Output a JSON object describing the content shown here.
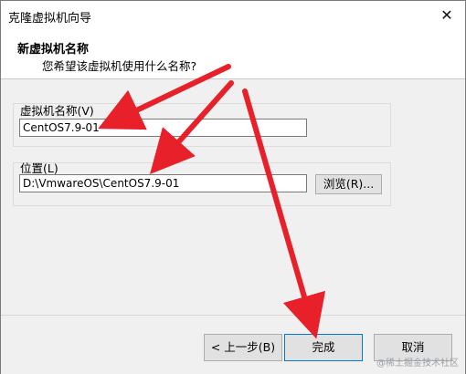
{
  "window": {
    "title": "克隆虚拟机向导",
    "close_glyph": "✕"
  },
  "header": {
    "title": "新虚拟机名称",
    "subtitle": "您希望该虚拟机使用什么名称?"
  },
  "name_group": {
    "label": "虚拟机名称(V)",
    "value": "CentOS7.9-01"
  },
  "location_group": {
    "label": "位置(L)",
    "value": "D:\\VmwareOS\\CentOS7.9-01",
    "browse_label": "浏览(R)..."
  },
  "footer": {
    "back_label": "< 上一步(B)",
    "finish_label": "完成",
    "cancel_label": "取消"
  },
  "watermark": "@稀土掘金技术社区",
  "colors": {
    "arrow": "#e8202a",
    "focus_border": "#0078d7",
    "dialog_bg": "#f0f0f0"
  }
}
